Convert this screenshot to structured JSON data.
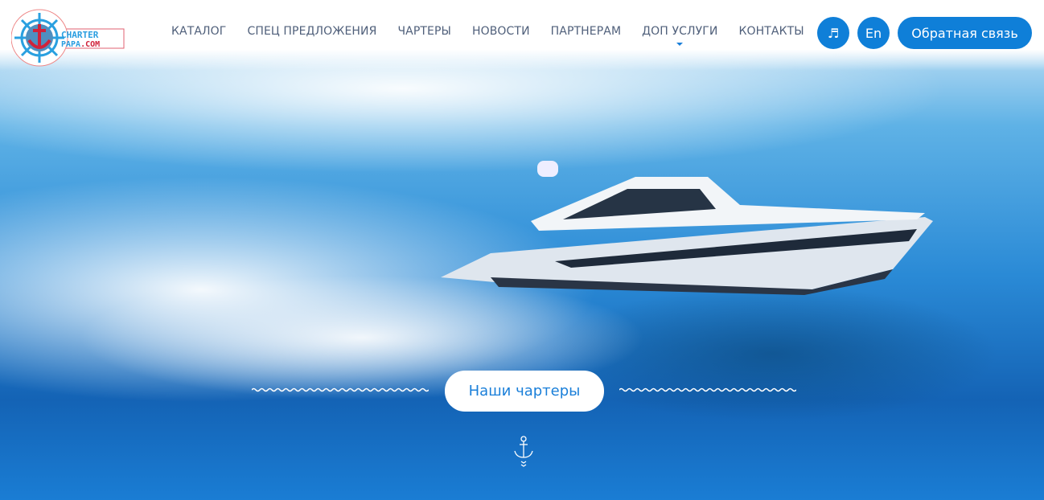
{
  "logo": {
    "text": "CHARTER PAPA.COM"
  },
  "nav": {
    "items": [
      {
        "label": "КАТАЛОГ"
      },
      {
        "label": "СПЕЦ ПРЕДЛОЖЕНИЯ"
      },
      {
        "label": "ЧАРТЕРЫ"
      },
      {
        "label": "НОВОСТИ"
      },
      {
        "label": "ПАРТНЕРАМ"
      },
      {
        "label": "ДОП УСЛУГИ",
        "has_dropdown": true
      },
      {
        "label": "КОНТАКТЫ"
      }
    ]
  },
  "header": {
    "music_icon": "music-note-icon",
    "lang_label": "En",
    "feedback_label": "Обратная связь"
  },
  "hero": {
    "cta_label": "Наши чартеры",
    "scroll_icon": "anchor-icon"
  },
  "colors": {
    "accent": "#0f7fd8",
    "nav_text": "#4f5f7a"
  }
}
